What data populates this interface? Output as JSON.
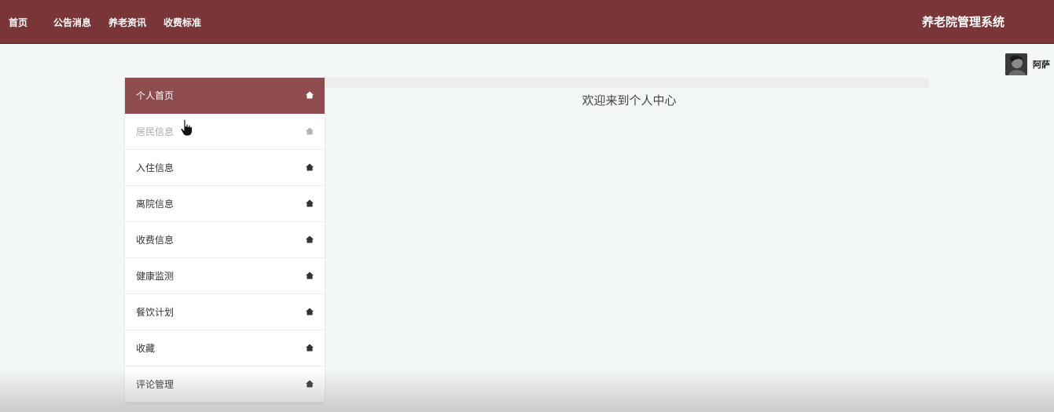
{
  "topnav": {
    "items": [
      {
        "label": "首页"
      },
      {
        "label": "公告消息"
      },
      {
        "label": "养老资讯"
      },
      {
        "label": "收费标准"
      }
    ],
    "system_title": "养老院管理系统"
  },
  "user": {
    "name": "阿萨",
    "avatar_icon": "avatar-photo"
  },
  "sidebar": {
    "items": [
      {
        "label": "个人首页",
        "icon": "home-icon",
        "state": "active"
      },
      {
        "label": "居民信息",
        "icon": "home-icon",
        "state": "hover"
      },
      {
        "label": "入住信息",
        "icon": "home-icon"
      },
      {
        "label": "离院信息",
        "icon": "home-icon"
      },
      {
        "label": "收费信息",
        "icon": "home-icon"
      },
      {
        "label": "健康监测",
        "icon": "home-icon"
      },
      {
        "label": "餐饮计划",
        "icon": "home-icon"
      },
      {
        "label": "收藏",
        "icon": "home-icon"
      },
      {
        "label": "评论管理",
        "icon": "home-icon"
      }
    ]
  },
  "main": {
    "welcome_text": "欢迎来到个人中心"
  },
  "colors": {
    "header_bg": "#7a3538",
    "active_item_bg": "#8f4c4f",
    "page_bg": "#f4f7f8"
  }
}
